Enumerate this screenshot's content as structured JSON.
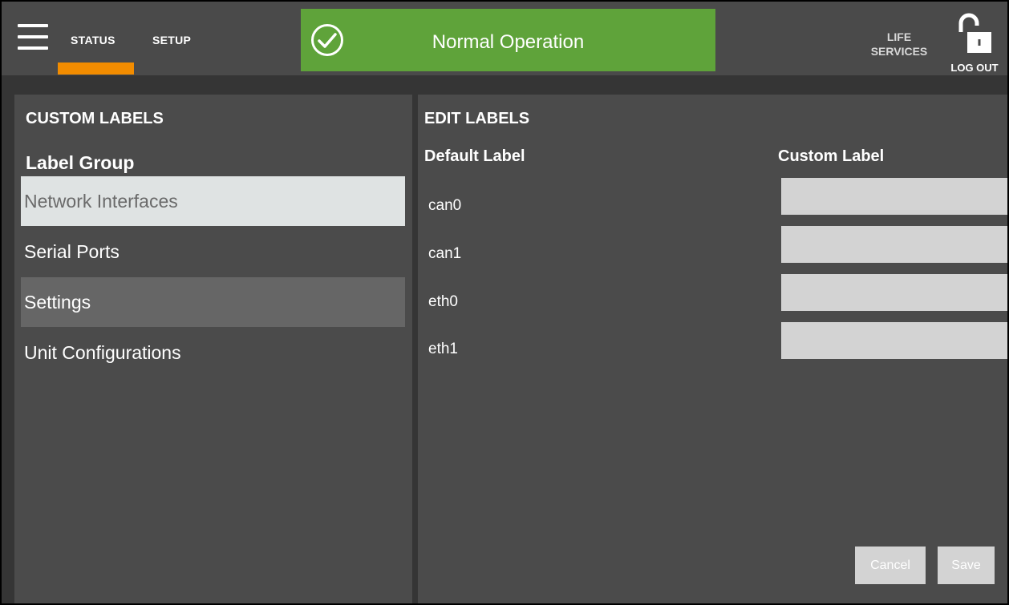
{
  "topbar": {
    "tabs": [
      "STATUS",
      "SETUP"
    ],
    "active_tab": "STATUS",
    "status_text": "Normal Operation",
    "status_color": "#5fa33a",
    "accent_color": "#f28c00",
    "life_services_line1": "LIFE",
    "life_services_line2": "SERVICES",
    "logout_label": "LOG OUT",
    "icons": [
      "menu-icon",
      "check-circle-icon",
      "unlocked-padlock-icon"
    ]
  },
  "left_panel": {
    "title": "CUSTOM LABELS",
    "group_heading": "Label Group",
    "groups": [
      {
        "label": "Network Interfaces",
        "state": "selected"
      },
      {
        "label": "Serial Ports",
        "state": "normal"
      },
      {
        "label": "Settings",
        "state": "hover"
      },
      {
        "label": "Unit Configurations",
        "state": "normal"
      }
    ]
  },
  "right_panel": {
    "title": "EDIT LABELS",
    "col_default": "Default Label",
    "col_custom": "Custom Label",
    "rows": [
      {
        "default": "can0",
        "custom": ""
      },
      {
        "default": "can1",
        "custom": ""
      },
      {
        "default": "eth0",
        "custom": ""
      },
      {
        "default": "eth1",
        "custom": ""
      }
    ],
    "cancel_label": "Cancel",
    "save_label": "Save"
  }
}
